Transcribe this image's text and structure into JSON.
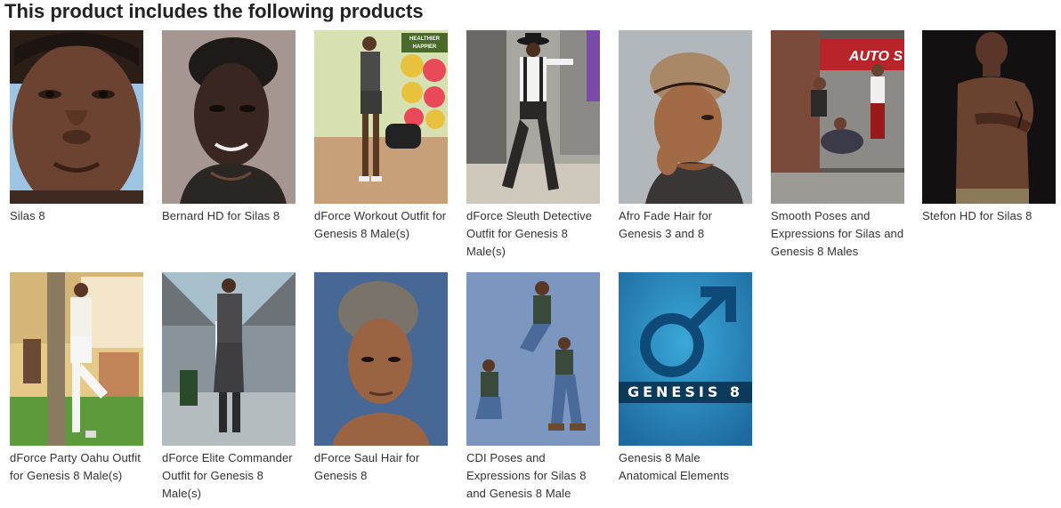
{
  "heading": "This product includes the following products",
  "products": [
    {
      "name": "Silas 8"
    },
    {
      "name": "Bernard HD for Silas 8"
    },
    {
      "name": "dForce Workout Outfit for Genesis 8 Male(s)",
      "poster": {
        "line1": "HEALTHIER",
        "line2": "HAPPIER"
      }
    },
    {
      "name": "dForce Sleuth Detective Outfit for Genesis 8 Male(s)"
    },
    {
      "name": "Afro Fade Hair for Genesis 3 and 8"
    },
    {
      "name": "Smooth Poses and Expressions for Silas and Genesis 8 Males",
      "sign": "AUTO S"
    },
    {
      "name": "Stefon HD for Silas 8"
    },
    {
      "name": "dForce Party Oahu Outfit for Genesis 8 Male(s)"
    },
    {
      "name": "dForce Elite Commander Outfit for Genesis 8 Male(s)"
    },
    {
      "name": "dForce Saul Hair for Genesis 8"
    },
    {
      "name": "CDI Poses and Expressions for Silas 8 and Genesis 8 Male"
    },
    {
      "name": "Genesis 8 Male Anatomical Elements",
      "logo_text": "GENESIS 8"
    }
  ]
}
